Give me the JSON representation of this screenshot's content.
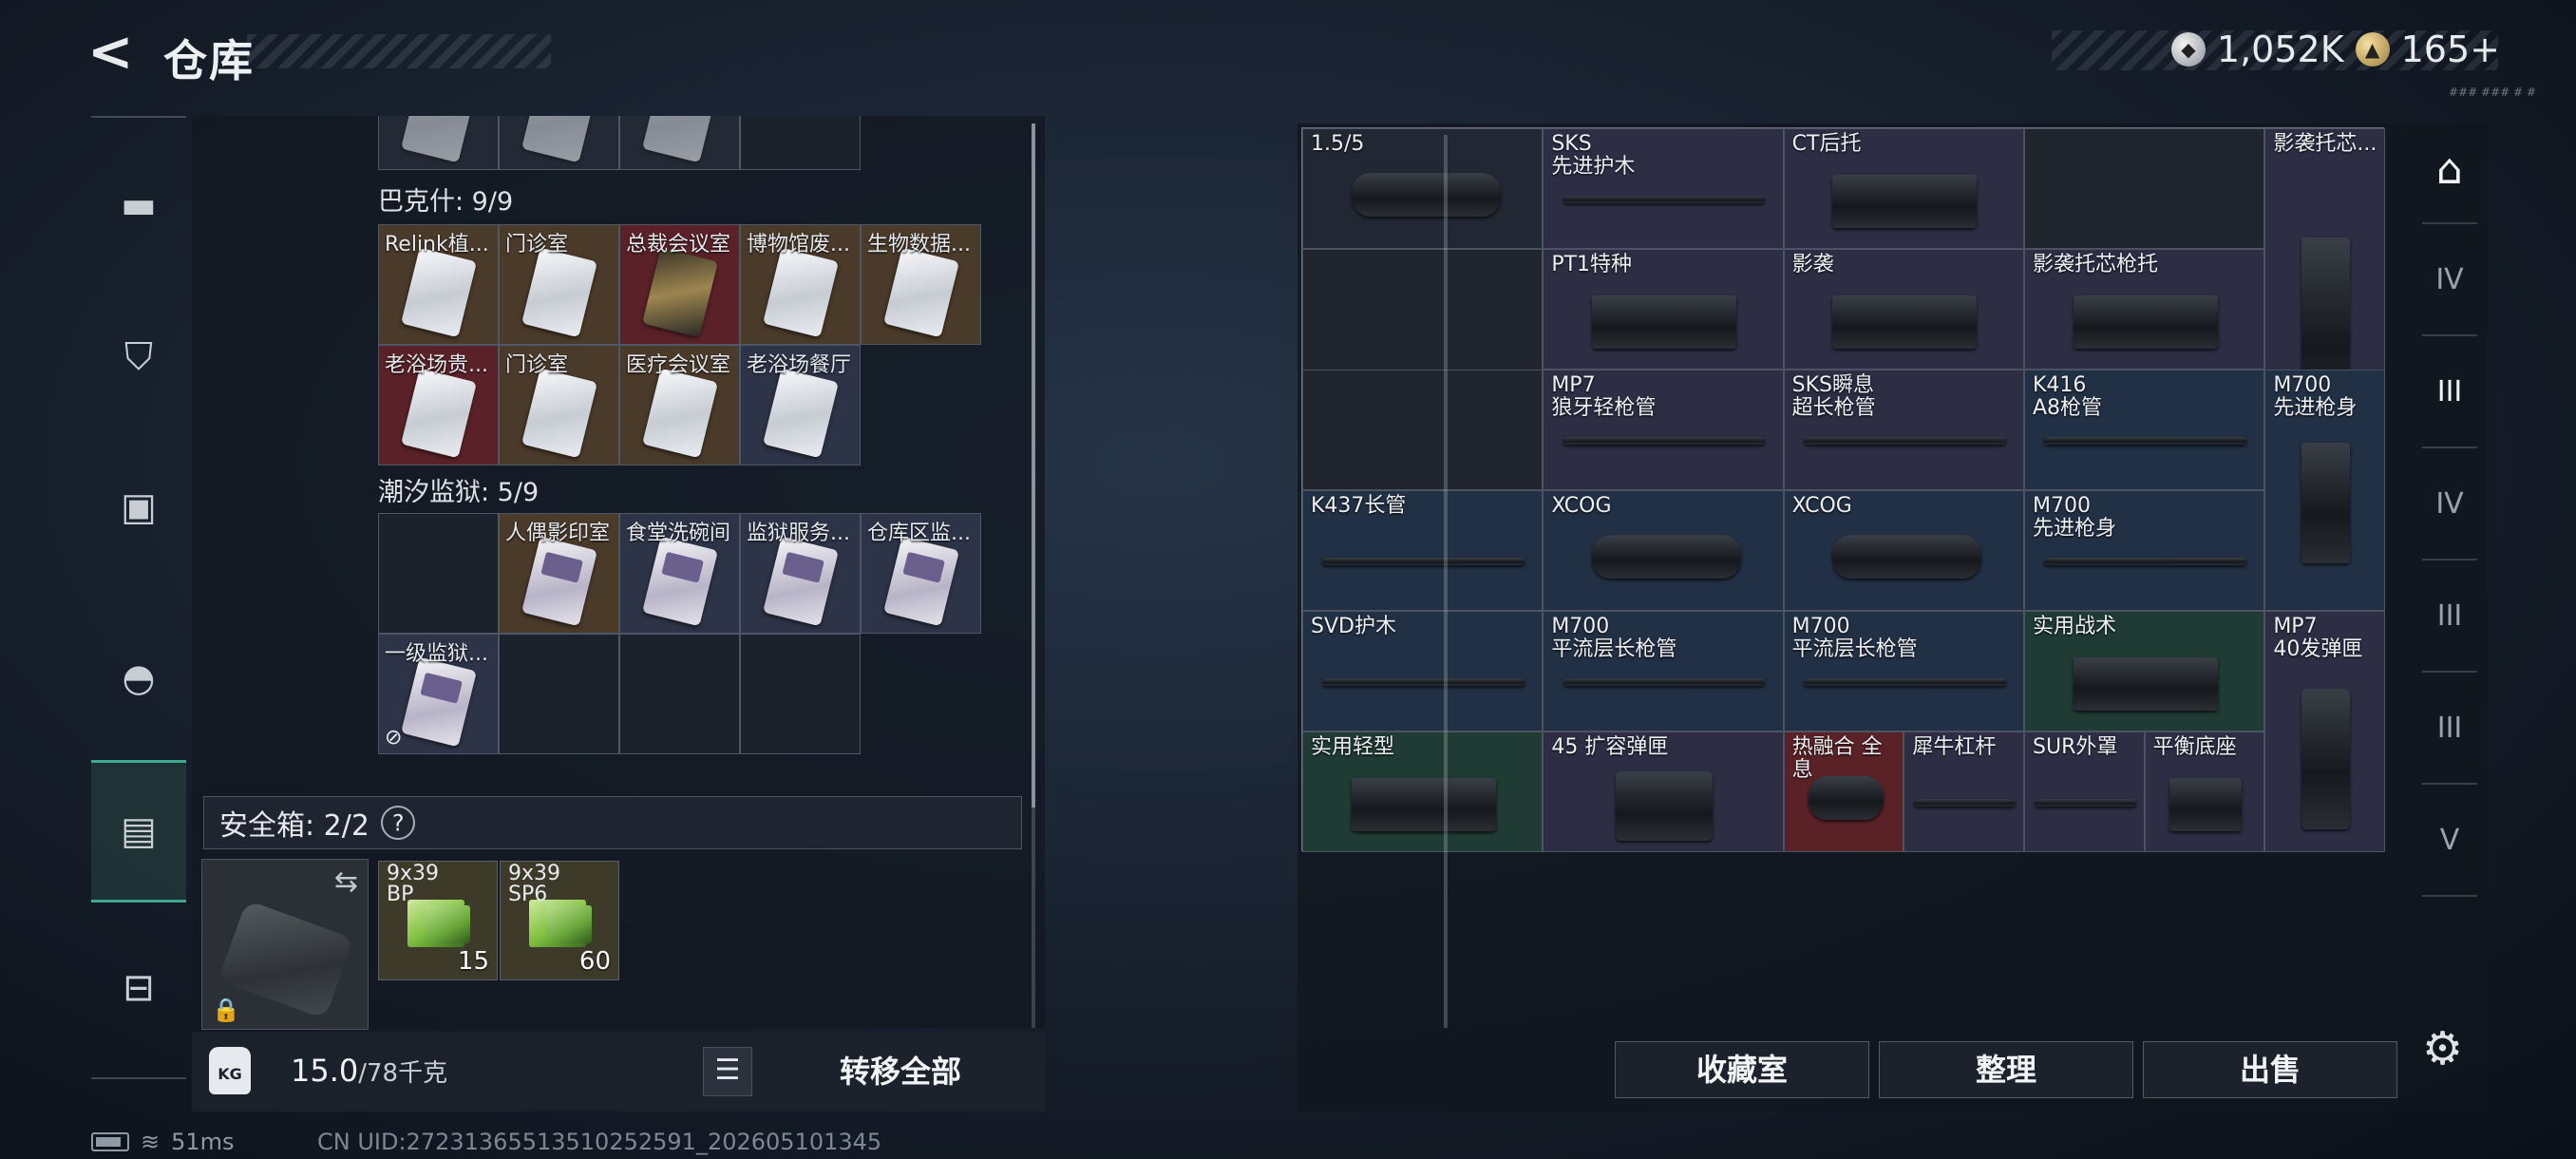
{
  "header": {
    "back_icon": "back-arrow-icon",
    "title": "仓库"
  },
  "currency": {
    "silver": "1,052K",
    "gold": "165+"
  },
  "mini_text": "### ### # #",
  "left_sidebar": [
    {
      "name": "weapon-tab",
      "icon": "pistol-icon"
    },
    {
      "name": "armor-tab",
      "icon": "vest-icon"
    },
    {
      "name": "backpack-tab",
      "icon": "backpack-icon"
    },
    {
      "name": "helmet-tab",
      "icon": "helmet-icon"
    },
    {
      "name": "container-tab",
      "icon": "container-icon"
    },
    {
      "name": "toolbox-tab",
      "icon": "toolbox-icon"
    }
  ],
  "stash": {
    "sections": [
      {
        "label": "巴克什: 9/9",
        "cells": [
          {
            "label": "Relink植...",
            "color": "brown",
            "card": "white"
          },
          {
            "label": "门诊室",
            "color": "brown",
            "card": "white"
          },
          {
            "label": "总裁会议室",
            "color": "red",
            "card": "gold"
          },
          {
            "label": "博物馆废...",
            "color": "brown",
            "card": "white"
          },
          {
            "label": "生物数据...",
            "color": "brown",
            "card": "white"
          },
          {
            "label": "老浴场贵...",
            "color": "red",
            "card": "white"
          },
          {
            "label": "门诊室",
            "color": "brown",
            "card": "white"
          },
          {
            "label": "医疗会议室",
            "color": "brown",
            "card": "white"
          },
          {
            "label": "老浴场餐厅",
            "color": "blue",
            "card": "white"
          }
        ]
      },
      {
        "label": "潮汐监狱: 5/9",
        "cells": [
          {
            "label": "",
            "color": "empty",
            "card": ""
          },
          {
            "label": "人偶影印室",
            "color": "brown",
            "card": "purple"
          },
          {
            "label": "食堂洗碗间",
            "color": "blue",
            "card": "purple"
          },
          {
            "label": "监狱服务...",
            "color": "blue",
            "card": "purple"
          },
          {
            "label": "仓库区监...",
            "color": "blue",
            "card": "purple"
          },
          {
            "label": "一级监狱...",
            "color": "blue",
            "card": "purple"
          },
          {
            "label": "",
            "color": "empty",
            "card": ""
          },
          {
            "label": "",
            "color": "empty",
            "card": ""
          },
          {
            "label": "",
            "color": "empty",
            "card": ""
          }
        ]
      }
    ]
  },
  "safe_box": {
    "title": "安全箱: 2/2",
    "help": "?",
    "ammo": [
      {
        "label_line1": "9x39",
        "label_line2": "BP",
        "count": "15"
      },
      {
        "label_line1": "9x39",
        "label_line2": "SP6",
        "count": "60"
      }
    ]
  },
  "weight": {
    "current": "15.0",
    "max": "/78千克",
    "icon_text": "KG"
  },
  "transfer_all": "转移全部",
  "status": {
    "ping": "51ms",
    "uid": "CN UID:27231365513510252591_202605101345"
  },
  "workshop": {
    "items": [
      {
        "label": "1.5/5",
        "color": "dark",
        "part": "scope"
      },
      {
        "label": "SKS\n先进护木",
        "color": "purple",
        "part": "rod"
      },
      {
        "label": "CT后托",
        "color": "purple",
        "part": "stock"
      },
      {
        "label": "影袭托芯...",
        "color": "purple",
        "part": "stock"
      },
      {
        "label": "PT1特种",
        "color": "purple",
        "part": "stock"
      },
      {
        "label": "影袭",
        "color": "purple",
        "part": "stock"
      },
      {
        "label": "影袭托芯枪托",
        "color": "purple",
        "part": "stock"
      },
      {
        "label": "MP7\n狼牙轻枪管",
        "color": "purple",
        "part": "rod"
      },
      {
        "label": "SKS瞬息\n超长枪管",
        "color": "purple",
        "part": "rod"
      },
      {
        "label": "K416\nA8枪管",
        "color": "blue",
        "part": "rod"
      },
      {
        "label": "M700\n先进枪身",
        "color": "blue",
        "part": "stock"
      },
      {
        "label": "K437长管",
        "color": "blue",
        "part": "rod"
      },
      {
        "label": "XCOG",
        "color": "blue",
        "part": "scope"
      },
      {
        "label": "XCOG",
        "color": "blue",
        "part": "scope"
      },
      {
        "label": "M700\n先进枪身",
        "color": "blue",
        "part": "rod"
      },
      {
        "label": "SVD护木",
        "color": "blue",
        "part": "rod"
      },
      {
        "label": "M700\n平流层长枪管",
        "color": "blue",
        "part": "rod"
      },
      {
        "label": "M700\n平流层长枪管",
        "color": "blue",
        "part": "rod"
      },
      {
        "label": "实用战术",
        "color": "green",
        "part": "stock"
      },
      {
        "label": "MP7\n40发弹匣",
        "color": "purple",
        "part": "mag"
      },
      {
        "label": "实用轻型",
        "color": "green",
        "part": "stock"
      },
      {
        "label": "45 扩容弹匣",
        "color": "purple",
        "part": "mag"
      },
      {
        "label": "热融合 全息",
        "color": "red",
        "part": "scope"
      },
      {
        "label": "犀牛杠杆",
        "color": "purple",
        "part": "rod"
      },
      {
        "label": "SUR外罩",
        "color": "purple",
        "part": "rod"
      },
      {
        "label": "平衡底座",
        "color": "purple",
        "part": "stock"
      }
    ]
  },
  "bottom_buttons": {
    "collection": "收藏室",
    "sort": "整理",
    "sell": "出售"
  },
  "right_sidebar": [
    {
      "name": "safe-room-tab",
      "icon": "vault-icon"
    },
    {
      "name": "tier-4-workbench-tab",
      "icon": "workbench-iv-icon",
      "text": "IV"
    },
    {
      "name": "tier-3-weapon-tab",
      "icon": "weapon-iii-icon",
      "text": "III"
    },
    {
      "name": "tier-4-armor-tab",
      "icon": "armor-iv-icon",
      "text": "IV"
    },
    {
      "name": "tier-3-armor-tab",
      "icon": "armor-iii-icon",
      "text": "III"
    },
    {
      "name": "tier-3-medical-tab",
      "icon": "medical-iii-icon",
      "text": "III"
    },
    {
      "name": "tier-5-tab",
      "icon": "tier-v-icon",
      "text": "V"
    }
  ],
  "settings_icon": "gear-icon"
}
